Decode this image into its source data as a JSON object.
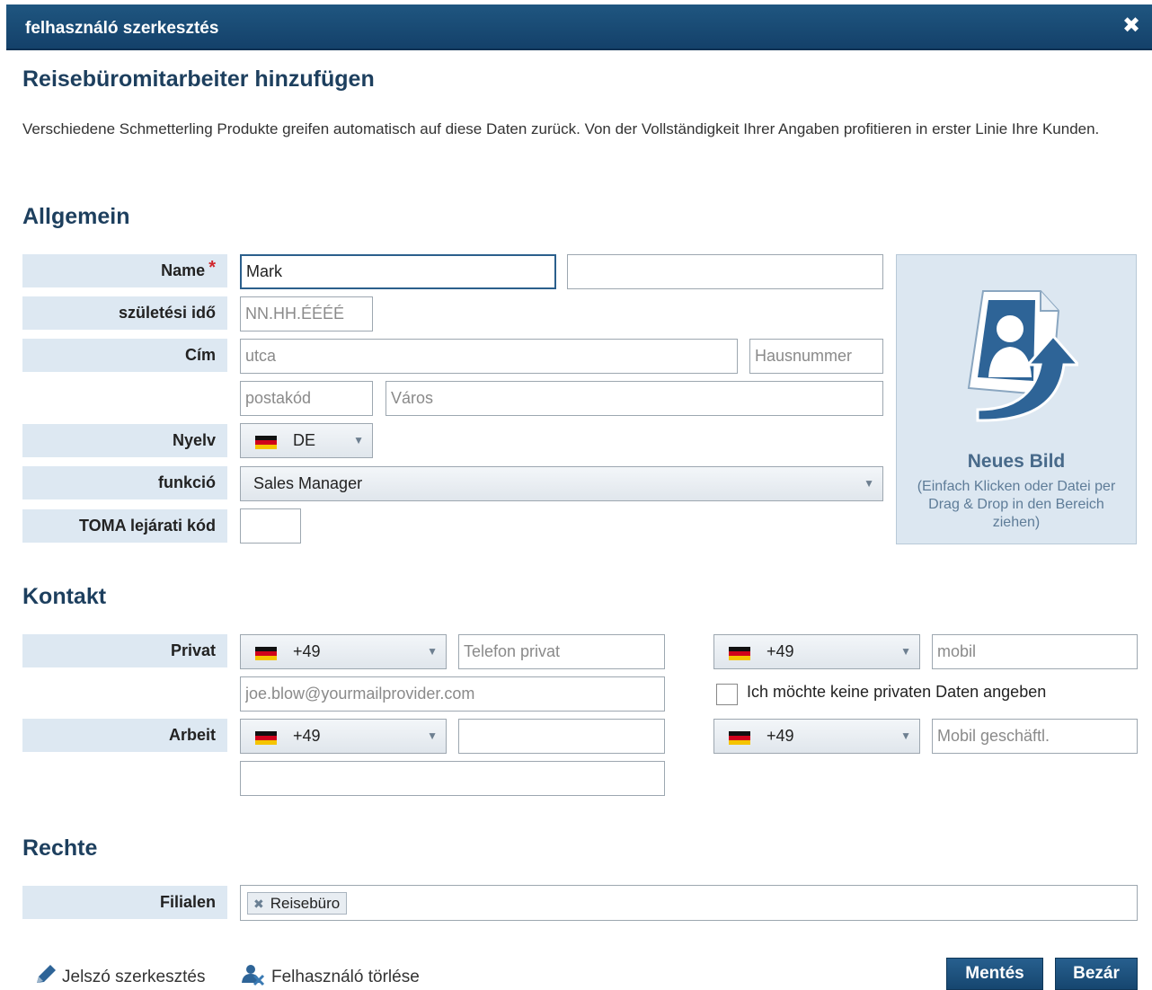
{
  "window": {
    "title": "felhasználó szerkesztés"
  },
  "page": {
    "title": "Reisebüromitarbeiter hinzufügen",
    "intro": "Verschiedene Schmetterling Produkte greifen automatisch auf diese Daten zurück. Von der Vollständigkeit Ihrer Angaben profitieren in erster Linie Ihre Kunden."
  },
  "general": {
    "heading": "Allgemein",
    "name_label": "Name",
    "name_required_mark": "*",
    "first_name_value": "Mark",
    "last_name_value": "",
    "birth_label": "születési idő",
    "birth_placeholder": "NN.HH.ÉÉÉÉ",
    "address_label": "Cím",
    "street_placeholder": "utca",
    "house_placeholder": "Hausnummer",
    "zip_placeholder": "postakód",
    "city_placeholder": "Város",
    "language_label": "Nyelv",
    "language_value": "DE",
    "function_label": "funkció",
    "function_value": "Sales Manager",
    "toma_label": "TOMA lejárati kód",
    "toma_value": ""
  },
  "photo": {
    "title": "Neues Bild",
    "hint": "(Einfach Klicken oder Datei per Drag & Drop in den Bereich ziehen)"
  },
  "contact": {
    "heading": "Kontakt",
    "private_label": "Privat",
    "private_phone_prefix": "+49",
    "private_phone_placeholder": "Telefon privat",
    "private_mobile_prefix": "+49",
    "private_mobile_placeholder": "mobil",
    "email_placeholder": "joe.blow@yourmailprovider.com",
    "no_private_data_label": "Ich möchte keine privaten Daten angeben",
    "work_label": "Arbeit",
    "work_phone_prefix": "+49",
    "work_phone_value": "",
    "work_mobile_prefix": "+49",
    "work_mobile_placeholder": "Mobil geschäftl.",
    "work_extra_value": ""
  },
  "rights": {
    "heading": "Rechte",
    "branches_label": "Filialen",
    "branches": [
      "Reisebüro"
    ]
  },
  "footer": {
    "password_link": "Jelszó szerkesztés",
    "delete_link": "Felhasználó törlése",
    "save_button": "Mentés",
    "close_button": "Bezár"
  },
  "colors": {
    "titlebar": "#1a4c78",
    "label_bg": "#dde8f2",
    "heading": "#1d3f5e",
    "required": "#d0262c"
  }
}
